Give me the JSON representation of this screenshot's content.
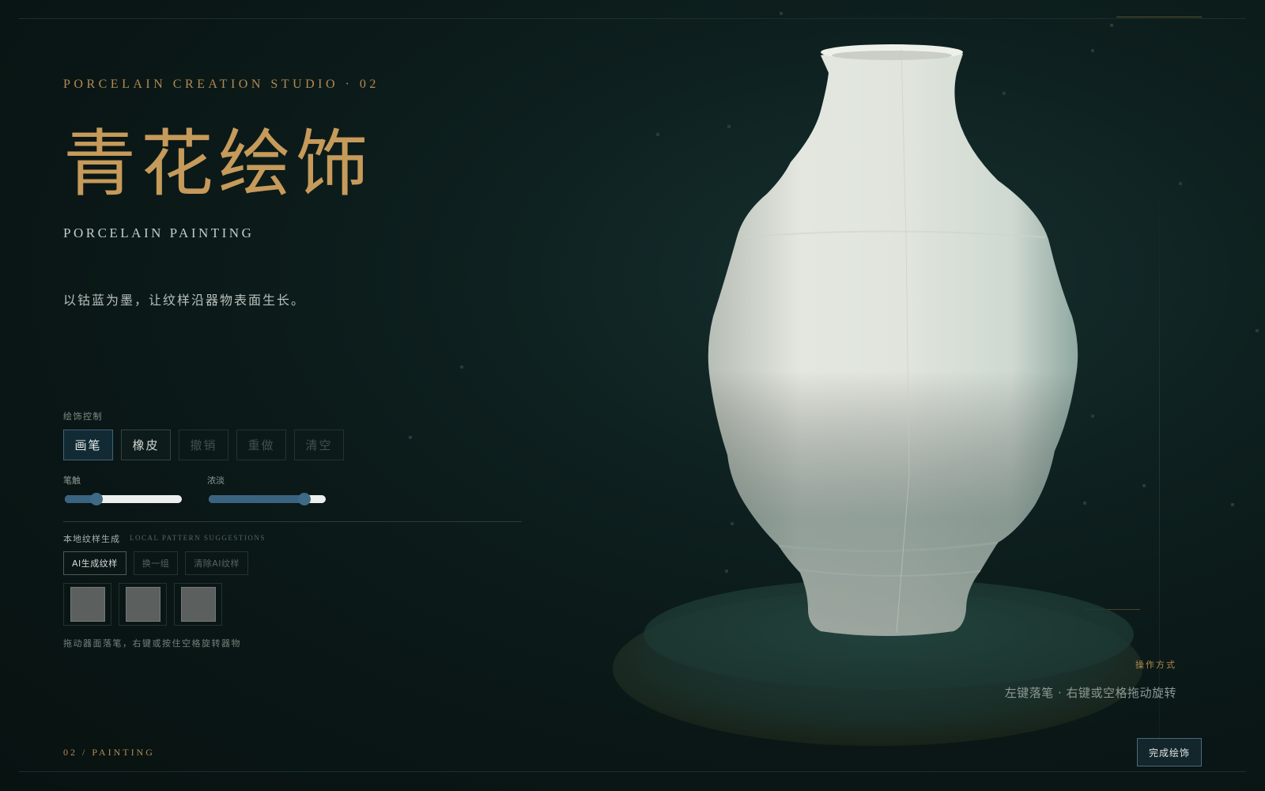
{
  "header": {
    "eyebrow": "PORCELAIN CREATION STUDIO · 02",
    "title": "青花绘饰",
    "subtitle": "PORCELAIN PAINTING",
    "description": "以钴蓝为墨，让纹样沿器物表面生长。"
  },
  "controls": {
    "section_label": "绘饰控制",
    "tools": [
      {
        "label": "画笔",
        "state": "active"
      },
      {
        "label": "橡皮",
        "state": "enabled"
      },
      {
        "label": "撤销",
        "state": "disabled"
      },
      {
        "label": "重做",
        "state": "disabled"
      },
      {
        "label": "清空",
        "state": "disabled"
      }
    ],
    "brush_size": {
      "label": "笔触",
      "value": 0.27
    },
    "opacity": {
      "label": "浓淡",
      "value": 0.82
    }
  },
  "generator": {
    "label": "本地纹样生成",
    "sublabel": "LOCAL PATTERN SUGGESTIONS",
    "buttons": [
      "AI生成纹样",
      "换一组",
      "清除AI纹样"
    ],
    "swatch_count": 3,
    "hint": "拖动器面落笔，右键或按住空格旋转器物"
  },
  "footer": {
    "step": "02 / PAINTING",
    "ops_title": "操作方式",
    "ops_text": "左键落笔 · 右键或空格拖动旋转",
    "done_label": "完成绘饰"
  },
  "colors": {
    "accent_gold": "#c69a5a",
    "cobalt": "#3a6380",
    "background": "#0a1716"
  }
}
